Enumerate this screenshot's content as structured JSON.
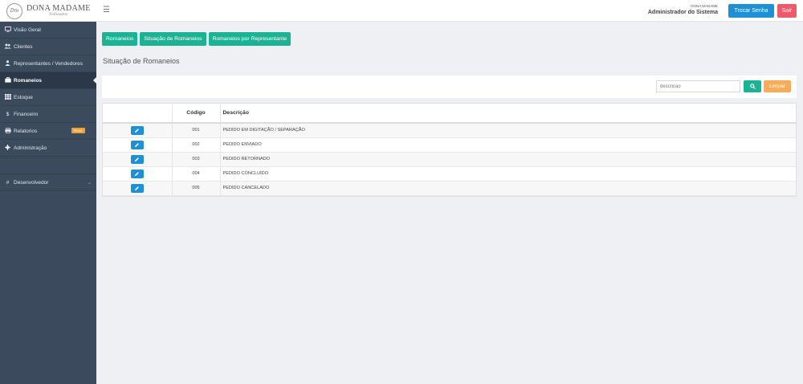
{
  "header": {
    "brand_name": "DONA MADAME",
    "brand_sub": "Folheados",
    "brand_logo": "Dm",
    "menu_icon": "☰",
    "user_company": "DONA MADAME",
    "user_role": "Administrador do Sistema",
    "change_password_label": "Trocar Senha",
    "logout_label": "Sair"
  },
  "sidebar": {
    "items": [
      {
        "label": "Visão Geral",
        "icon": "monitor-icon"
      },
      {
        "label": "Clientes",
        "icon": "users-icon"
      },
      {
        "label": "Representantes / Vendedores",
        "icon": "user-tie-icon"
      },
      {
        "label": "Romaneios",
        "icon": "briefcase-icon",
        "active": true
      },
      {
        "label": "Estoque",
        "icon": "grid-icon"
      },
      {
        "label": "Financeiro",
        "icon": "dollar-icon"
      },
      {
        "label": "Relatorios",
        "icon": "print-icon",
        "badge": "Novo"
      },
      {
        "label": "Administração",
        "icon": "gear-icon"
      },
      {
        "label": "Desenvolvedor",
        "icon": "hash-icon"
      }
    ]
  },
  "tabs": [
    "Romaneios",
    "Situação de Romaneios",
    "Romaneios por Representante"
  ],
  "page_title": "Situação de Romaneios",
  "search": {
    "placeholder": "descricao",
    "clear_label": "Limpar"
  },
  "table": {
    "columns": [
      "",
      "Código",
      "Descrição"
    ],
    "rows": [
      {
        "code": "001",
        "description": "PEDIDO EM DIGITAÇÃO / SEPARAÇÃO"
      },
      {
        "code": "002",
        "description": "PEDIDO ENVIADO"
      },
      {
        "code": "003",
        "description": "PEDIDO RETORNADO"
      },
      {
        "code": "004",
        "description": "PEDIDO CONCLUÍDO"
      },
      {
        "code": "005",
        "description": "PEDIDO CANCELADO"
      }
    ]
  },
  "colors": {
    "accent_green": "#1cb394",
    "accent_blue": "#1e90d8",
    "danger": "#f0596a",
    "warning": "#f8ac59",
    "sidebar_bg": "#3b4b5d"
  }
}
